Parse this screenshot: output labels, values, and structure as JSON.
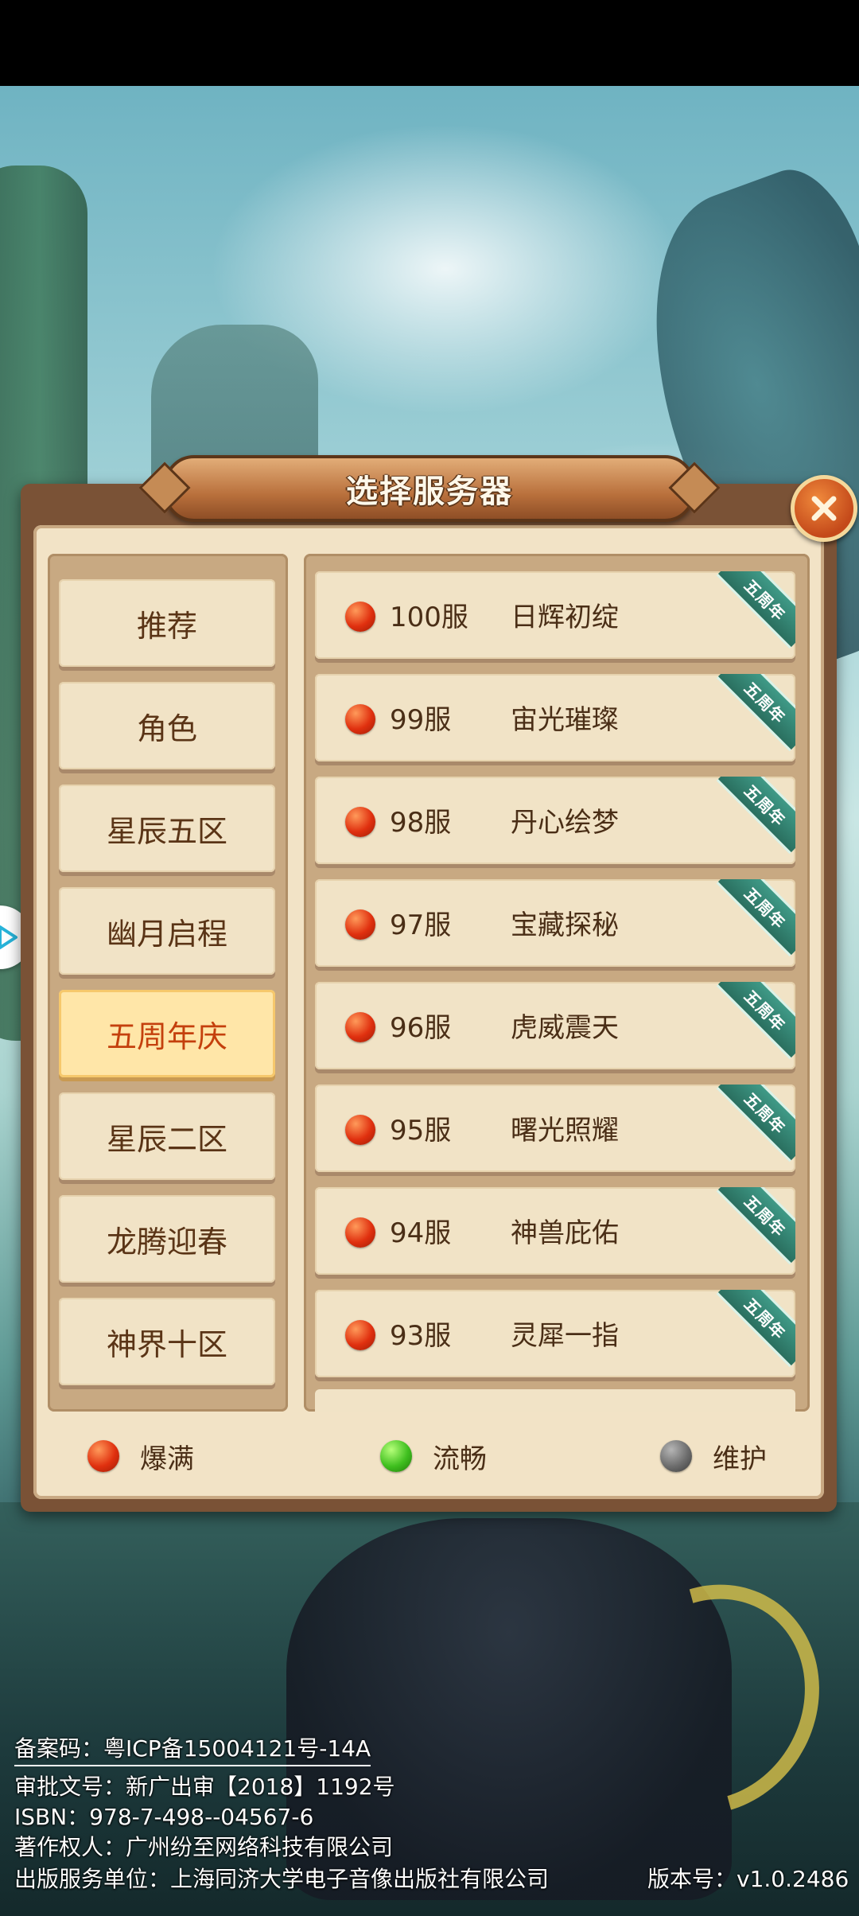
{
  "dialog": {
    "title": "选择服务器"
  },
  "categories": [
    {
      "label": "推荐",
      "active": false
    },
    {
      "label": "角色",
      "active": false
    },
    {
      "label": "星辰五区",
      "active": false
    },
    {
      "label": "幽月启程",
      "active": false
    },
    {
      "label": "五周年庆",
      "active": true
    },
    {
      "label": "星辰二区",
      "active": false
    },
    {
      "label": "龙腾迎春",
      "active": false
    },
    {
      "label": "神界十区",
      "active": false
    }
  ],
  "servers": [
    {
      "number": "100服",
      "name": "日辉初绽",
      "status": "爆满",
      "tag": "五周年"
    },
    {
      "number": "99服",
      "name": "宙光璀璨",
      "status": "爆满",
      "tag": "五周年"
    },
    {
      "number": "98服",
      "name": "丹心绘梦",
      "status": "爆满",
      "tag": "五周年"
    },
    {
      "number": "97服",
      "name": "宝藏探秘",
      "status": "爆满",
      "tag": "五周年"
    },
    {
      "number": "96服",
      "name": "虎威震天",
      "status": "爆满",
      "tag": "五周年"
    },
    {
      "number": "95服",
      "name": "曙光照耀",
      "status": "爆满",
      "tag": "五周年"
    },
    {
      "number": "94服",
      "name": "神兽庇佑",
      "status": "爆满",
      "tag": "五周年"
    },
    {
      "number": "93服",
      "name": "灵犀一指",
      "status": "爆满",
      "tag": "五周年"
    }
  ],
  "legend": [
    {
      "label": "爆满",
      "color": "#e0300f"
    },
    {
      "label": "流畅",
      "color": "#3fbf1f"
    },
    {
      "label": "维护",
      "color": "#6d6d6d"
    }
  ],
  "footer": {
    "icp": "备案码：粤ICP备15004121号-14A",
    "approval": "审批文号：新广出审【2018】1192号",
    "isbn": "ISBN：978-7-498--04567-6",
    "copyright": "著作权人：广州纷至网络科技有限公司",
    "publisher": "出版服务单位：上海同济大学电子音像出版社有限公司",
    "version": "版本号：v1.0.2486"
  },
  "icons": {
    "close": "close-icon",
    "side": "play-icon",
    "status": "status-dot-icon"
  }
}
